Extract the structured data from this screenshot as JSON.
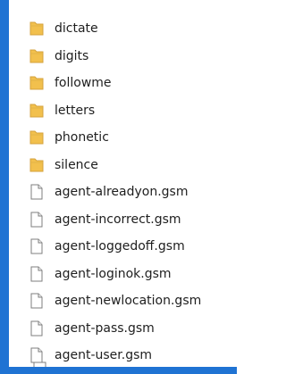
{
  "folders": [
    {
      "name": "dictate",
      "icon": "folder-icon"
    },
    {
      "name": "digits",
      "icon": "folder-icon"
    },
    {
      "name": "followme",
      "icon": "folder-icon"
    },
    {
      "name": "letters",
      "icon": "folder-icon"
    },
    {
      "name": "phonetic",
      "icon": "folder-icon"
    },
    {
      "name": "silence",
      "icon": "folder-icon"
    }
  ],
  "files": [
    {
      "name": "agent-alreadyon.gsm",
      "icon": "file-icon"
    },
    {
      "name": "agent-incorrect.gsm",
      "icon": "file-icon"
    },
    {
      "name": "agent-loggedoff.gsm",
      "icon": "file-icon"
    },
    {
      "name": "agent-loginok.gsm",
      "icon": "file-icon"
    },
    {
      "name": "agent-newlocation.gsm",
      "icon": "file-icon"
    },
    {
      "name": "agent-pass.gsm",
      "icon": "file-icon"
    },
    {
      "name": "agent-user.gsm",
      "icon": "file-icon"
    }
  ],
  "colors": {
    "border_accent": "#1f73d3",
    "folder": "#f2c04d",
    "text": "#1e1e1e"
  }
}
